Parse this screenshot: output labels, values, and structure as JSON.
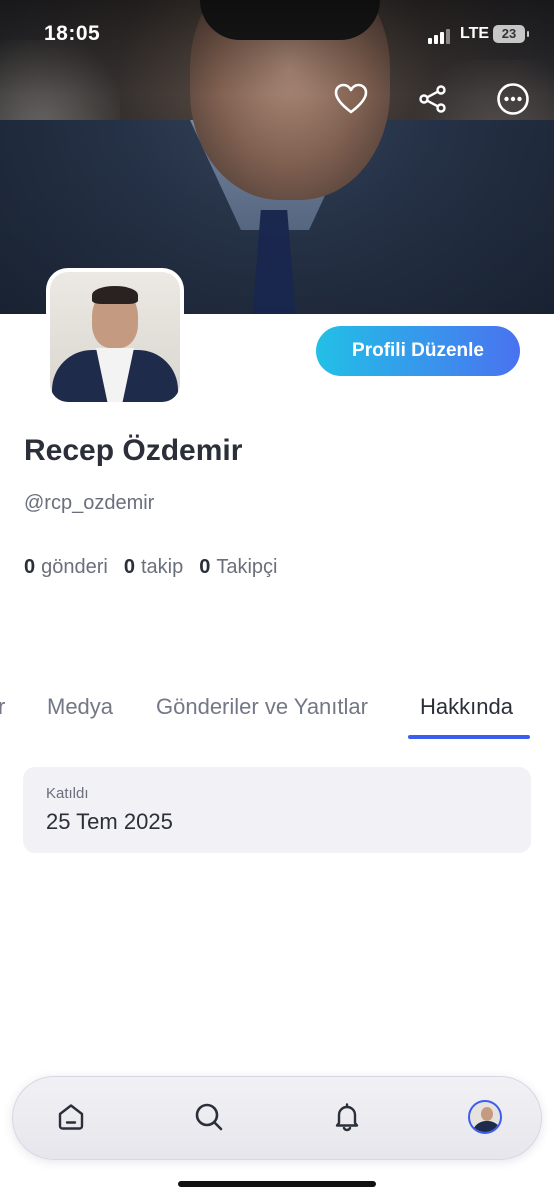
{
  "status_bar": {
    "time": "18:05",
    "network": "LTE",
    "battery": "23"
  },
  "header": {
    "icons": [
      "heart-icon",
      "share-icon",
      "more-icon"
    ]
  },
  "profile": {
    "edit_button": "Profili Düzenle",
    "name": "Recep Özdemir",
    "handle": "@rcp_ozdemir",
    "stats": {
      "posts_count": "0",
      "posts_label": "gönderi",
      "following_count": "0",
      "following_label": "takip",
      "followers_count": "0",
      "followers_label": "Takipçi"
    }
  },
  "tabs": {
    "items": [
      {
        "label": "r"
      },
      {
        "label": "Medya"
      },
      {
        "label": "Gönderiler ve Yanıtlar"
      },
      {
        "label": "Hakkında"
      }
    ],
    "active": "Hakkında"
  },
  "about": {
    "joined_label": "Katıldı",
    "joined_value": "25 Tem 2025"
  },
  "bottom_nav": {
    "icons": [
      "home-icon",
      "search-icon",
      "bell-icon",
      "profile-avatar"
    ]
  },
  "colors": {
    "accent": "#3b5df0",
    "edit_button_gradient_start": "#22c0e6",
    "edit_button_gradient_end": "#4a72f0",
    "text_primary": "#2b2f3a",
    "text_secondary": "#6b6f7c"
  }
}
